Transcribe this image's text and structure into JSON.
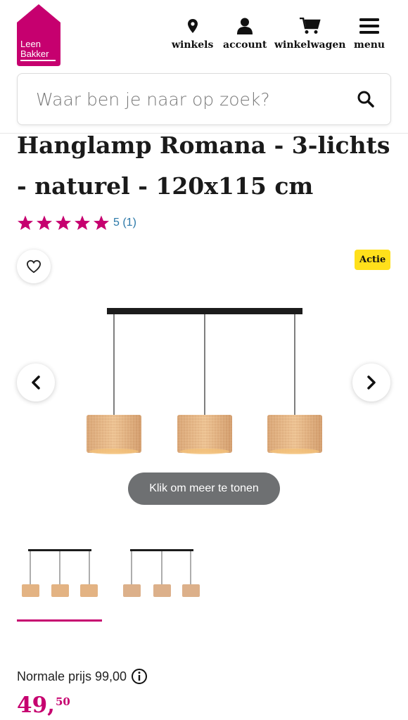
{
  "header": {
    "logo_line1": "Leen",
    "logo_line2": "Bakker",
    "nav": [
      {
        "label": "winkels",
        "icon": "location-pin-icon"
      },
      {
        "label": "account",
        "icon": "user-icon"
      },
      {
        "label": "winkelwagen",
        "icon": "cart-icon"
      },
      {
        "label": "menu",
        "icon": "hamburger-menu-icon"
      }
    ]
  },
  "search": {
    "placeholder": "Waar ben je naar op zoek?",
    "value": "",
    "icon": "search-icon"
  },
  "product": {
    "title": "Hanglamp Romana - 3-lichts - naturel - 120x115 cm",
    "rating_text": "5 (1)",
    "stars": 5,
    "badge": "Actie",
    "more_label": "Klik om meer te tonen",
    "normal_price_label": "Normale prijs 99,00",
    "price_main": "49,",
    "price_cents": "50"
  },
  "colors": {
    "brand": "#c6006f",
    "badge": "#ffe01b",
    "rating_text": "#2a78a8"
  }
}
